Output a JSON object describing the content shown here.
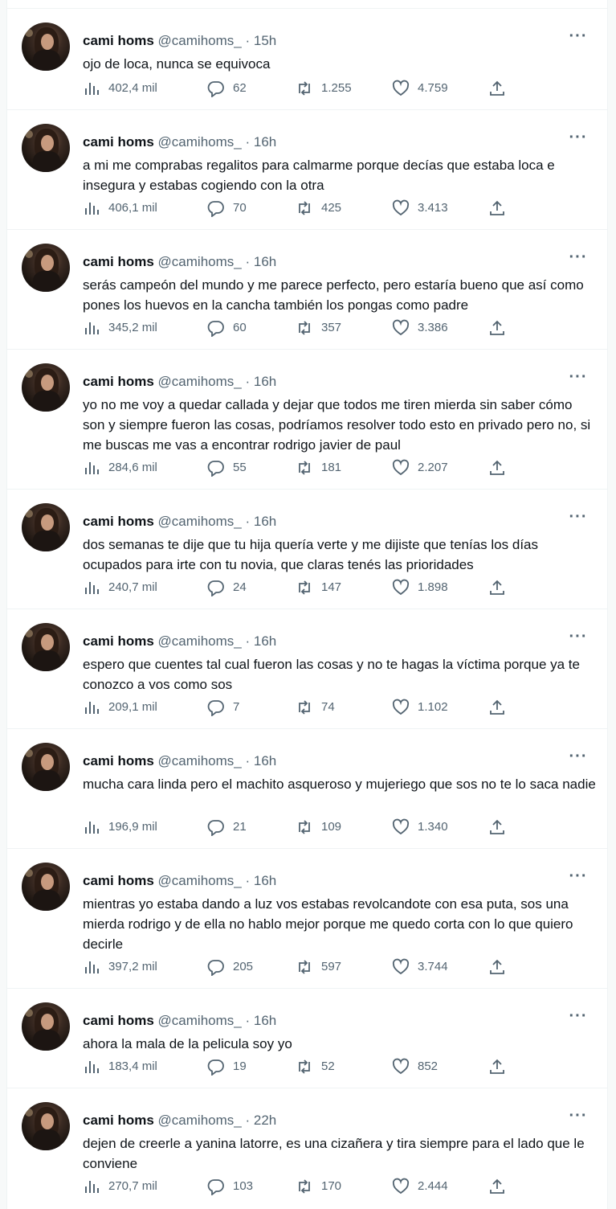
{
  "author": {
    "name": "cami homs",
    "handle": "@camihoms_",
    "separator": "·"
  },
  "icons": {
    "more": "more-dots-icon",
    "views": "views-bar-chart-icon",
    "reply": "reply-bubble-icon",
    "retweet": "retweet-icon",
    "like": "heart-icon",
    "share": "share-upload-icon"
  },
  "tweets": [
    {
      "time": "15h",
      "text": "ojo de loca, nunca se equivoca",
      "views": "402,4 mil",
      "replies": "62",
      "retweets": "1.255",
      "likes": "4.759"
    },
    {
      "time": "16h",
      "text": "a mi me comprabas regalitos para calmarme porque decías que estaba loca e insegura y estabas cogiendo con la otra",
      "views": "406,1 mil",
      "replies": "70",
      "retweets": "425",
      "likes": "3.413"
    },
    {
      "time": "16h",
      "text": "serás campeón del mundo y me parece perfecto, pero estaría bueno que así como pones los huevos en la cancha también los pongas como padre",
      "views": "345,2 mil",
      "replies": "60",
      "retweets": "357",
      "likes": "3.386"
    },
    {
      "time": "16h",
      "text": "yo no me voy a quedar callada y dejar que todos me tiren mierda sin saber cómo son y siempre fueron las cosas, podríamos resolver todo esto en privado pero no, si me buscas me vas a encontrar rodrigo javier de paul",
      "views": "284,6 mil",
      "replies": "55",
      "retweets": "181",
      "likes": "2.207"
    },
    {
      "time": "16h",
      "text": "dos semanas te dije que tu hija quería verte y me dijiste que tenías los días ocupados para irte con tu novia, que claras tenés las prioridades",
      "views": "240,7 mil",
      "replies": "24",
      "retweets": "147",
      "likes": "1.898"
    },
    {
      "time": "16h",
      "text": "espero que cuentes tal cual fueron las cosas y no te hagas la víctima porque ya te conozco a vos como sos",
      "views": "209,1 mil",
      "replies": "7",
      "retweets": "74",
      "likes": "1.102"
    },
    {
      "time": "16h",
      "text": "mucha cara linda pero el machito asqueroso y mujeriego que sos no te lo saca nadie",
      "views": "196,9 mil",
      "replies": "21",
      "retweets": "109",
      "likes": "1.340"
    },
    {
      "time": "16h",
      "text": "mientras yo estaba dando a luz vos estabas revolcandote con esa puta, sos una mierda rodrigo y de ella no hablo mejor porque me quedo corta con lo que quiero decirle",
      "views": "397,2 mil",
      "replies": "205",
      "retweets": "597",
      "likes": "3.744"
    },
    {
      "time": "16h",
      "text": "ahora la mala de la pelicula soy yo",
      "views": "183,4 mil",
      "replies": "19",
      "retweets": "52",
      "likes": "852"
    },
    {
      "time": "22h",
      "text": "dejen de creerle a yanina latorre, es una cizañera y tira siempre para el lado que le conviene",
      "views": "270,7 mil",
      "replies": "103",
      "retweets": "170",
      "likes": "2.444"
    }
  ]
}
